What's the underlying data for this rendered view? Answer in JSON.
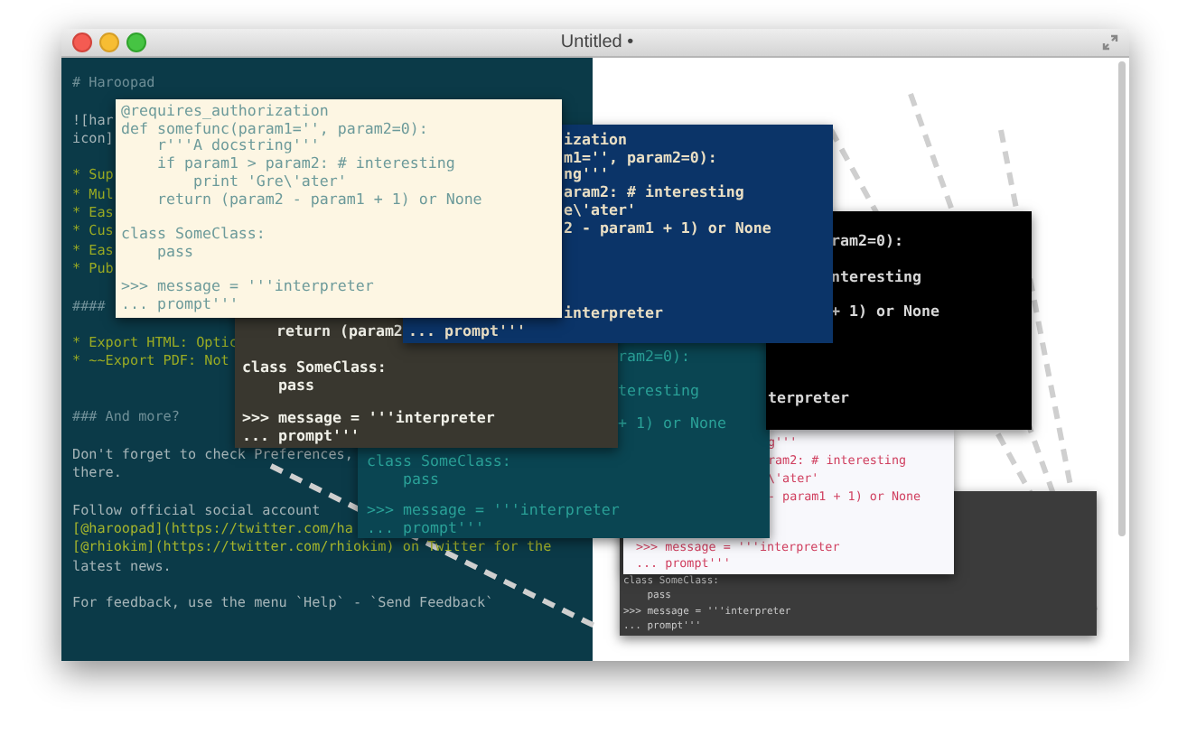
{
  "window": {
    "title": "Untitled •"
  },
  "editor": {
    "paragraphs": [
      {
        "lines": [
          {
            "text": "# Haroopad",
            "kind": "heading"
          }
        ]
      },
      {
        "lines": [
          {
            "text": "![har",
            "kind": "text"
          },
          {
            "text": "icon]",
            "kind": "text"
          }
        ]
      },
      {
        "lines": [
          {
            "text": "* Sup",
            "kind": "bullet"
          },
          {
            "text": "* Mul",
            "kind": "bullet"
          },
          {
            "text": "* Eas",
            "kind": "bullet"
          },
          {
            "text": "* Cus",
            "kind": "bullet"
          },
          {
            "text": "* Eas",
            "kind": "bullet"
          },
          {
            "text": "* Pub",
            "kind": "bullet"
          }
        ]
      },
      {
        "lines": [
          {
            "text": "####",
            "kind": "heading"
          }
        ]
      },
      {
        "lines": [
          {
            "text": "* Export HTML: Optic",
            "kind": "bullet"
          },
          {
            "text": "* ~~Export PDF: Not",
            "kind": "bullet"
          }
        ]
      },
      {
        "lines": [
          {
            "text": "### And more?",
            "kind": "heading"
          }
        ]
      },
      {
        "lines": [
          {
            "text": "Don't forget to check Preferences,",
            "kind": "text"
          },
          {
            "text": "there.",
            "kind": "text"
          }
        ]
      },
      {
        "lines": [
          {
            "text": "Follow official social account",
            "kind": "text"
          },
          {
            "text": "[@haroopad](https://twitter.com/ha",
            "kind": "link"
          },
          {
            "text": "[@rhiokim](https://twitter.com/rhiokim) on Twitter for the",
            "kind": "link"
          },
          {
            "text": "latest news.",
            "kind": "text"
          }
        ]
      },
      {
        "lines": [
          {
            "text": "For feedback, use the menu `Help` - `Send Feedback`",
            "kind": "text"
          }
        ]
      }
    ]
  },
  "cards": [
    {
      "kind": "cream",
      "blocks": [
        [
          "@requires_authorization",
          "def somefunc(param1='', param2=0):",
          "    r'''A docstring'''",
          "    if param1 > param2: # interesting",
          "        print 'Gre\\'ater'",
          "    return (param2 - param1 + 1) or None"
        ],
        [
          "class SomeClass:",
          "    pass"
        ],
        [
          ">>> message = '''interpreter",
          "... prompt'''"
        ]
      ]
    },
    {
      "kind": "navy",
      "blocks": [
        [
          "ization",
          "m1='', param2=0):",
          "ng'''",
          "aram2: # interesting",
          "e\\'ater'",
          "2 - param1 + 1) or None"
        ],
        [
          "interpreter"
        ],
        [
          "... prompt'''"
        ]
      ]
    },
    {
      "kind": "monokai",
      "blocks": [
        [
          "return (param2"
        ],
        [
          "class SomeClass:",
          "    pass"
        ],
        [
          ">>> message = '''interpreter",
          "... prompt'''"
        ]
      ]
    },
    {
      "kind": "black",
      "blocks": [
        [
          "ram2=0):",
          "nteresting",
          "+ 1) or None"
        ],
        [
          "terpreter"
        ]
      ]
    },
    {
      "kind": "teal",
      "blocks": [
        [
          "ram2=0):",
          "teresting",
          "+ 1) or None"
        ],
        [
          "class SomeClass:",
          "    pass"
        ],
        [
          ">>> message = '''interpreter",
          "... prompt'''"
        ]
      ]
    },
    {
      "kind": "light",
      "blocks": [
        [
          "g'''",
          "ram2: # interesting",
          "\\'ater'",
          "- param1 + 1) or None"
        ],
        [
          ">>> message = '''interpreter",
          "... prompt'''"
        ]
      ]
    },
    {
      "kind": "dark",
      "blocks": [
        [
          "class SomeClass:",
          "    pass"
        ],
        [
          ">>> message = '''interpreter",
          "... prompt'''"
        ]
      ]
    }
  ]
}
